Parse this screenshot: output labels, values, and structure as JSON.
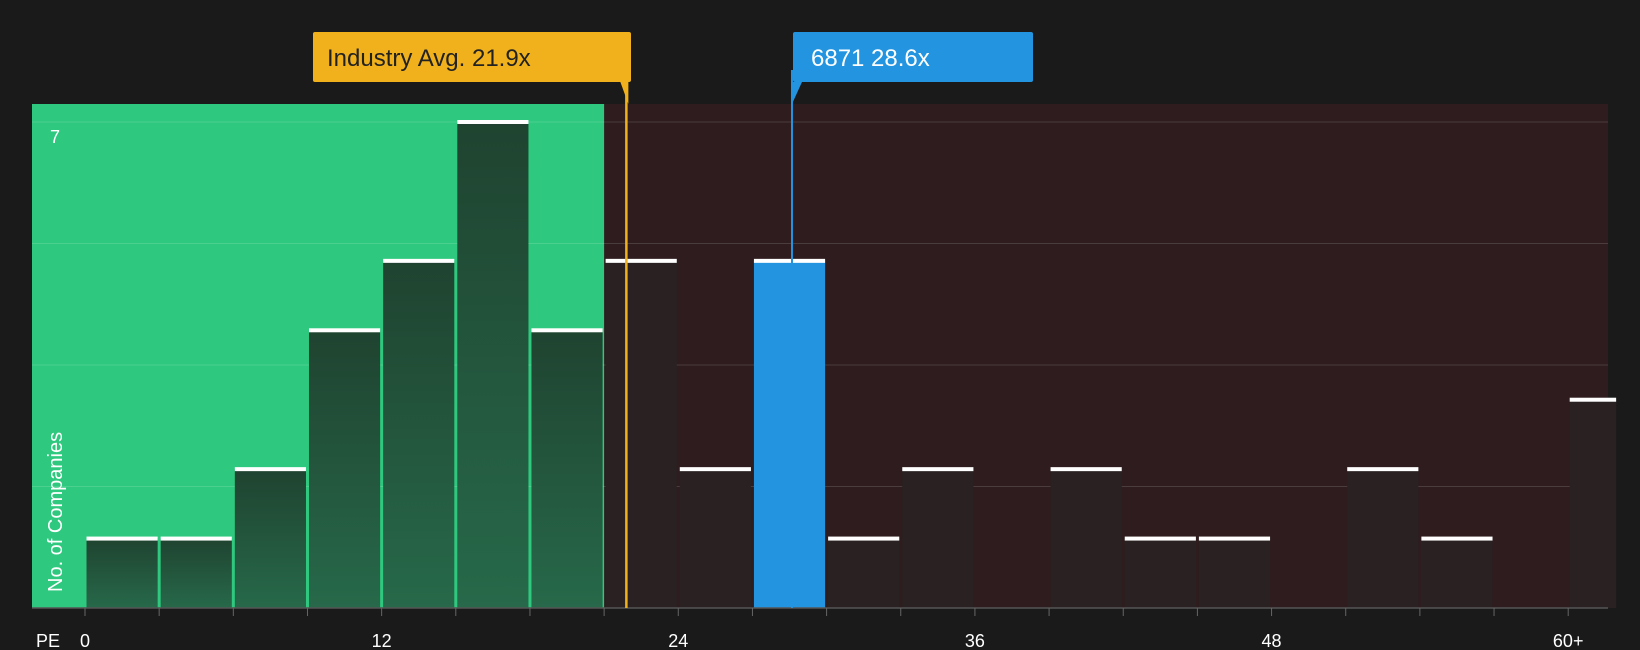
{
  "chart_data": {
    "type": "bar",
    "xlabel": "PE",
    "ylabel": "No. of Companies",
    "ymax_label": "7",
    "ylim": [
      0,
      7
    ],
    "xlim": [
      0,
      62
    ],
    "x_ticks": [
      {
        "value": 0,
        "label": "0"
      },
      {
        "value": 12,
        "label": "12"
      },
      {
        "value": 24,
        "label": "24"
      },
      {
        "value": 36,
        "label": "36"
      },
      {
        "value": 48,
        "label": "48"
      },
      {
        "value": 60,
        "label": "60+"
      }
    ],
    "bins": [
      {
        "x0": 0,
        "x1": 3,
        "count": 1
      },
      {
        "x0": 3,
        "x1": 6,
        "count": 1
      },
      {
        "x0": 6,
        "x1": 9,
        "count": 2
      },
      {
        "x0": 9,
        "x1": 12,
        "count": 4
      },
      {
        "x0": 12,
        "x1": 15,
        "count": 5
      },
      {
        "x0": 15,
        "x1": 18,
        "count": 7
      },
      {
        "x0": 18,
        "x1": 21,
        "count": 4
      },
      {
        "x0": 21,
        "x1": 24,
        "count": 5
      },
      {
        "x0": 24,
        "x1": 27,
        "count": 2
      },
      {
        "x0": 27,
        "x1": 30,
        "count": 5,
        "highlight": true
      },
      {
        "x0": 30,
        "x1": 33,
        "count": 1
      },
      {
        "x0": 33,
        "x1": 36,
        "count": 2
      },
      {
        "x0": 39,
        "x1": 42,
        "count": 2
      },
      {
        "x0": 42,
        "x1": 45,
        "count": 1
      },
      {
        "x0": 45,
        "x1": 48,
        "count": 1
      },
      {
        "x0": 51,
        "x1": 54,
        "count": 2
      },
      {
        "x0": 54,
        "x1": 57,
        "count": 1
      },
      {
        "x0": 60,
        "x1": 62,
        "count": 3
      }
    ],
    "industry_avg": {
      "label": "Industry Avg. 21.9x",
      "value": 21.9
    },
    "company": {
      "label": "6871 28.6x",
      "value": 28.6
    },
    "green_zone_end": 21,
    "colors": {
      "background": "#1a1a1a",
      "green_zone": "#2ec97e",
      "red_zone": "#2e1c1e",
      "bar_in_green": "#235034",
      "bar_in_red": "#2a2222",
      "highlight": "#2394e0",
      "industry": "#f0b11d",
      "cap": "#ffffff",
      "grid": "#4a3c3e"
    }
  }
}
